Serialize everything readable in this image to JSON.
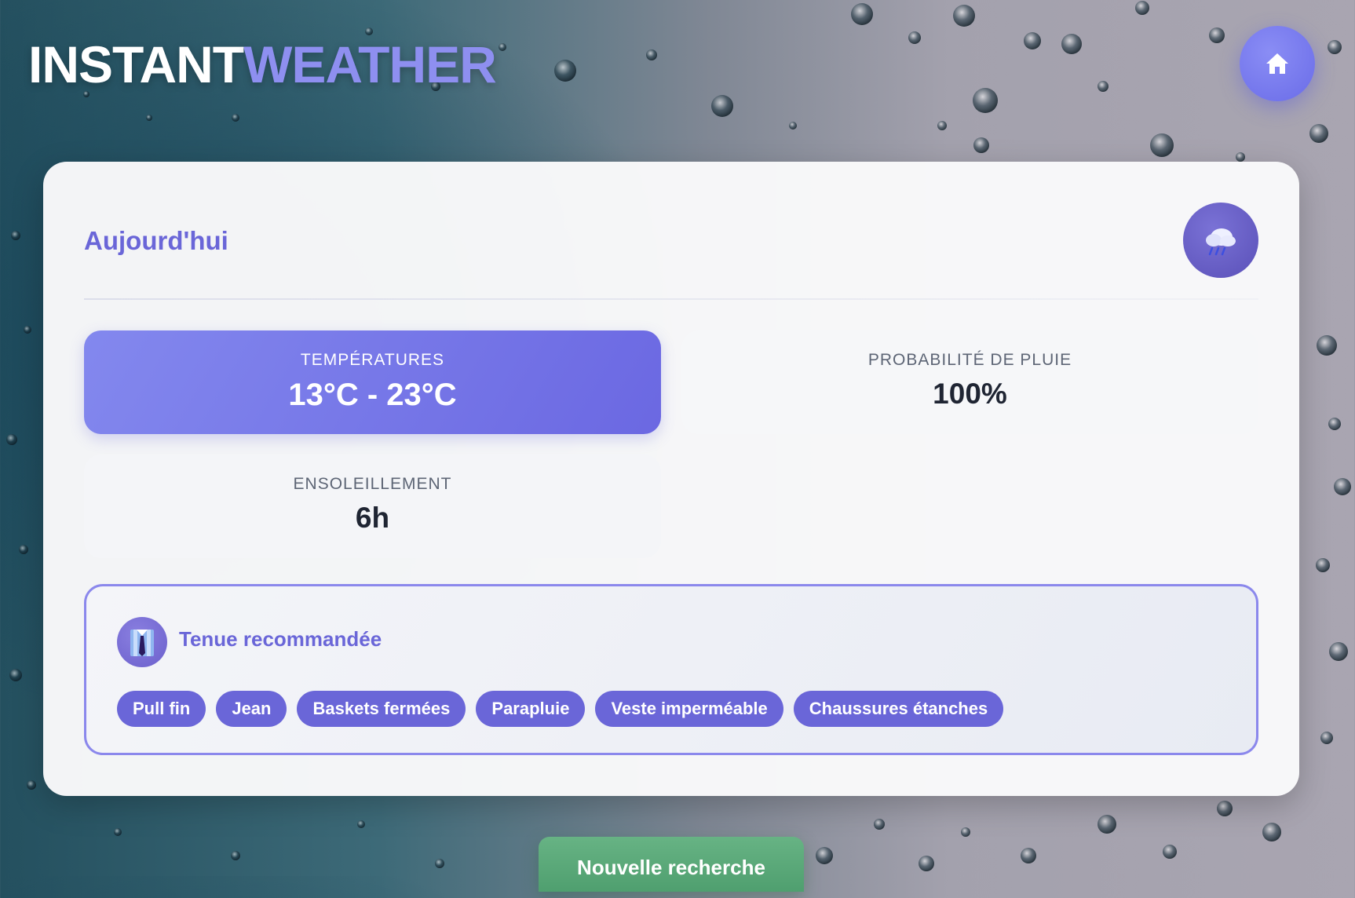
{
  "header": {
    "brand_part1": "INSTANT",
    "brand_part2": "WEATHER",
    "home_icon": "home-icon"
  },
  "forecast": {
    "day_title": "Aujourd'hui",
    "weather_icon": "rain-cloud-icon",
    "stats": {
      "temperature": {
        "label": "TEMPÉRATURES",
        "value": "13°C - 23°C"
      },
      "rain": {
        "label": "PROBABILITÉ DE PLUIE",
        "value": "100%"
      },
      "sunshine": {
        "label": "ENSOLEILLEMENT",
        "value": "6h"
      }
    },
    "outfit": {
      "icon": "shirt-tie-icon",
      "title": "Tenue recommandée",
      "items": [
        "Pull fin",
        "Jean",
        "Baskets fermées",
        "Parapluie",
        "Veste imperméable",
        "Chaussures étanches"
      ]
    }
  },
  "actions": {
    "new_search_label": "Nouvelle recherche"
  },
  "colors": {
    "accent": "#6a66d8",
    "accent_light": "#8e8ff0",
    "success": "#5aa978",
    "text_dark": "#1f2533",
    "text_muted": "#5d6575"
  }
}
